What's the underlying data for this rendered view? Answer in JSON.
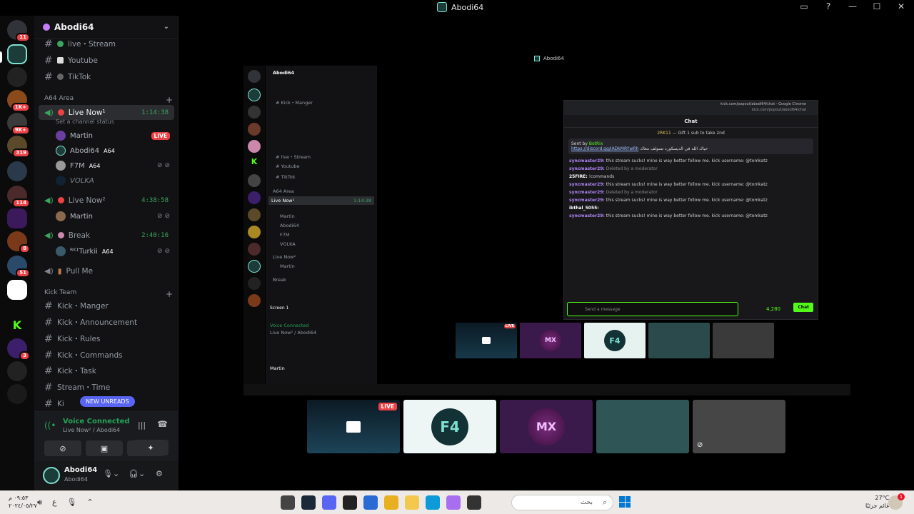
{
  "window": {
    "title": "Abodi64",
    "controls": [
      "window-icon",
      "help-icon",
      "minimize-icon",
      "maximize-icon",
      "close-icon"
    ]
  },
  "guild": {
    "name": "Abodi64"
  },
  "channels": [
    {
      "name": "live・Stream",
      "dot": "#3ba55d"
    },
    {
      "name": "Youtube",
      "dot": "#ffffff"
    },
    {
      "name": "TikTok",
      "dot": "#666666"
    }
  ],
  "categories": {
    "a64_area": "A64 Area",
    "kick_team": "Kick Team"
  },
  "voice_channels": {
    "live_now_1": {
      "name": "Live Now¹",
      "timer": "1:14:38",
      "status": "Set a channel status"
    },
    "live_now_2": {
      "name": "Live Now²",
      "timer": "4:38:58"
    },
    "break": {
      "name": "Break",
      "timer": "2:40:16"
    },
    "pull_me": {
      "name": "Pull Me"
    }
  },
  "members_live1": [
    {
      "name": "Martin",
      "badge": "LIVE"
    },
    {
      "name": "Abodi64",
      "tag": "A64"
    },
    {
      "name": "F7M",
      "tag": "A64"
    },
    {
      "name": "VOLKA"
    }
  ],
  "members_live2": [
    {
      "name": "Martin"
    }
  ],
  "members_break": [
    {
      "name": "ᴿᴷ¹Turkii",
      "tag": "A64"
    }
  ],
  "kick_channels": [
    "Kick・Manger",
    "Kick・Announcement",
    "Kick・Rules",
    "Kick・Commands",
    "Kick・Task",
    "Stream・Time",
    "Ki"
  ],
  "new_unreads": "NEW UNREADS",
  "voice_connected": {
    "title": "Voice Connected",
    "sub": "Live Now² / Abodi64"
  },
  "user": {
    "name": "Abodi64",
    "status": "Abodi64"
  },
  "rail_badges": [
    "11",
    "1K+",
    "9K+",
    "319",
    "114",
    "8",
    "51",
    "3"
  ],
  "stream": {
    "inner_title": "Abodi64",
    "chrome_url": "kick.com/popout/abodi64/chat - Google Chrome",
    "chrome_addr": "kick.com/popout/abodi64/chat",
    "chat_header": "Chat",
    "gift_user": "2RK11",
    "gift_text": "Gift 1 sub to take 2nd",
    "pinned_by": "Sent by",
    "pinned_bot": "BotRix",
    "pinned_link": "https://discord.gg/IADkMRYwRh",
    "pinned_arabic": "حياك الله في الديسكورد تسولف معاك",
    "messages": [
      {
        "user": "syncmaster29:",
        "text": "this stream sucks! mine is way better follow me. kick username: @tomkatz"
      },
      {
        "user": "syncmaster29:",
        "text": "Deleted by a moderator"
      },
      {
        "user": "25FIRE:",
        "text": "!commands"
      },
      {
        "user": "syncmaster29:",
        "text": "this stream sucks! mine is way better follow me. kick username: @tomkatz"
      },
      {
        "user": "syncmaster29:",
        "text": "Deleted by a moderator"
      },
      {
        "user": "syncmaster29:",
        "text": "this stream sucks! mine is way better follow me. kick username: @tomkatz"
      },
      {
        "user": "ibthal_5055:",
        "text": ""
      },
      {
        "user": "syncmaster29:",
        "text": "this stream sucks! mine is way better follow me. kick username: @tomkatz"
      }
    ],
    "input_placeholder": "Send a message",
    "kick_count": "4,280",
    "chat_button": "Chat",
    "live_badge": "LIVE"
  },
  "taskbar": {
    "time": "٠٩:٥٣ م",
    "date": "٢٠٢٤/٠٥/٢٧",
    "search": "بحث",
    "temp": "27°C",
    "weather": "غائم جزئيًا",
    "notif": "1"
  },
  "colors": {
    "accent_green": "#23a55a",
    "kick_green": "#53fc18",
    "live_red": "#ed4245"
  }
}
